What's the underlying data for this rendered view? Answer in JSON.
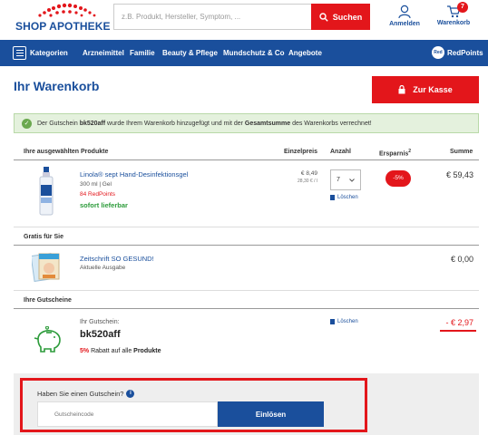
{
  "header": {
    "brand": "SHOP APOTHEKE",
    "search_placeholder": "z.B. Produkt, Hersteller, Symptom, ...",
    "search_button": "Suchen",
    "account_label": "Anmelden",
    "cart_label": "Warenkorb",
    "cart_count": "7"
  },
  "nav": {
    "categories_label": "Kategorien",
    "items": [
      "Arzneimittel",
      "Familie",
      "Beauty & Pflege",
      "Mundschutz & Co",
      "Angebote"
    ],
    "redpoints_icon_text": "Red",
    "redpoints_label": "RedPoints"
  },
  "page": {
    "title": "Ihr Warenkorb",
    "checkout_button": "Zur Kasse"
  },
  "notice": {
    "part1": "Der Gutschein ",
    "code": "bk520aff",
    "part2": " wurde Ihrem Warenkorb hinzugefügt und mit der ",
    "emphasis": "Gesamtsumme",
    "part3": " des Warenkorbs verrechnet!"
  },
  "table_headers": {
    "products": "Ihre ausgewählten Produkte",
    "unit_price": "Einzelpreis",
    "quantity": "Anzahl",
    "savings": "Ersparnis",
    "savings_sup": "2",
    "sum": "Summe"
  },
  "product": {
    "name": "Linola® sept Hand-Desinfektionsgel",
    "size": "300 ml | Gel",
    "redpoints": "84 RedPoints",
    "availability": "sofort lieferbar",
    "unit_price": "€ 8,49",
    "base_price": "28,30 € / l",
    "quantity": "7",
    "delete_label": "Löschen",
    "savings": "-5%",
    "sum": "€ 59,43"
  },
  "gift_section": {
    "heading": "Gratis für Sie",
    "name": "Zeitschrift SO GESUND!",
    "subtitle": "Aktuelle Ausgabe",
    "sum": "€ 0,00"
  },
  "coupon_section": {
    "heading": "Ihre Gutscheine",
    "label": "Ihr Gutschein:",
    "code": "bk520aff",
    "discount_pct": "5%",
    "discount_text": " Rabatt auf alle ",
    "discount_target": "Produkte",
    "delete_label": "Löschen",
    "sum": "- € 2,97"
  },
  "voucher": {
    "question": "Haben Sie einen Gutschein?",
    "info_icon": "i",
    "placeholder": "Gutscheincode",
    "button": "Einlösen"
  },
  "colors": {
    "brand_blue": "#1a4f9c",
    "accent_red": "#e3161b",
    "success_green": "#2c9b3a"
  }
}
